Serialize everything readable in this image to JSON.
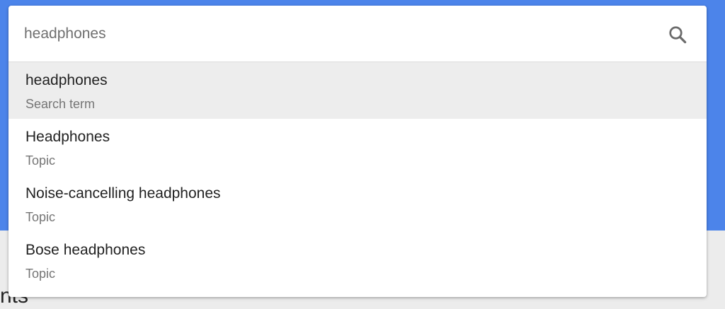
{
  "background": {
    "accent_color": "#4c84ea",
    "partial_text": "nts"
  },
  "search": {
    "value": "headphones",
    "icon": "search-icon"
  },
  "suggestions": [
    {
      "title": "headphones",
      "type": "Search term",
      "highlighted": true
    },
    {
      "title": "Headphones",
      "type": "Topic",
      "highlighted": false
    },
    {
      "title": "Noise-cancelling headphones",
      "type": "Topic",
      "highlighted": false
    },
    {
      "title": "Bose headphones",
      "type": "Topic",
      "highlighted": false
    }
  ]
}
